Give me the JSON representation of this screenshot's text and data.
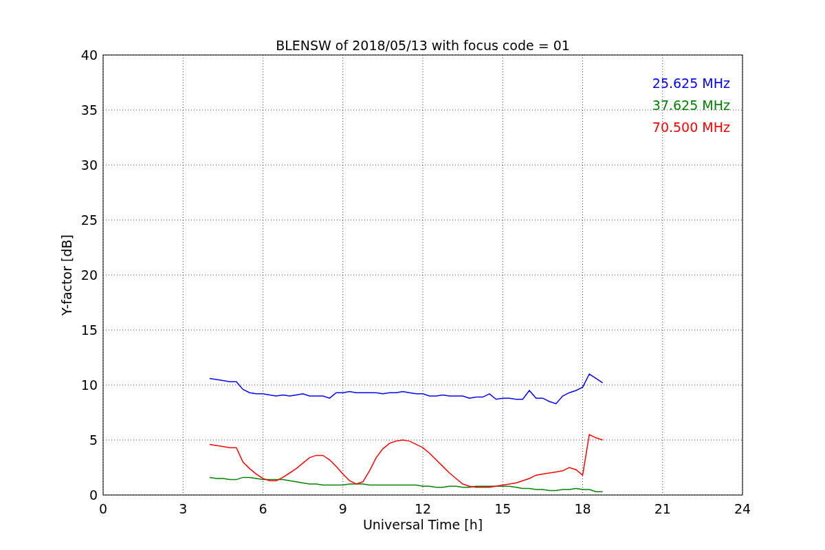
{
  "figure": {
    "chart_data": {
      "type": "line",
      "title": "BLENSW of 2018/05/13 with focus code = 01",
      "xlabel": "Universal Time [h]",
      "ylabel": "Y-factor [dB]",
      "grid": true,
      "xlim": [
        0,
        24
      ],
      "ylim": [
        0,
        40
      ],
      "xticks": [
        0,
        3,
        6,
        9,
        12,
        15,
        18,
        21,
        24
      ],
      "yticks": [
        0,
        5,
        10,
        15,
        20,
        25,
        30,
        35,
        40
      ],
      "x": [
        4,
        4.25,
        4.5,
        4.75,
        5,
        5.25,
        5.5,
        5.75,
        6,
        6.25,
        6.5,
        6.75,
        7,
        7.25,
        7.5,
        7.75,
        8,
        8.25,
        8.5,
        8.75,
        9,
        9.25,
        9.5,
        9.75,
        10,
        10.25,
        10.5,
        10.75,
        11,
        11.25,
        11.5,
        11.75,
        12,
        12.25,
        12.5,
        12.75,
        13,
        13.25,
        13.5,
        13.75,
        14,
        14.25,
        14.5,
        14.75,
        15,
        15.25,
        15.5,
        15.75,
        16,
        16.25,
        16.5,
        16.75,
        17,
        17.25,
        17.5,
        17.75,
        18,
        18.25,
        18.5,
        18.75
      ],
      "series": [
        {
          "name": "25.625 MHz",
          "color": "#0000ff",
          "values": [
            10.6,
            10.5,
            10.4,
            10.3,
            10.3,
            9.6,
            9.3,
            9.2,
            9.2,
            9.1,
            9.0,
            9.1,
            9.0,
            9.1,
            9.2,
            9.0,
            9.0,
            9.0,
            8.8,
            9.3,
            9.3,
            9.4,
            9.3,
            9.3,
            9.3,
            9.3,
            9.2,
            9.3,
            9.3,
            9.4,
            9.3,
            9.2,
            9.2,
            9.0,
            9.0,
            9.1,
            9.0,
            9.0,
            9.0,
            8.8,
            8.9,
            8.9,
            9.2,
            8.7,
            8.8,
            8.8,
            8.7,
            8.7,
            9.5,
            8.8,
            8.8,
            8.5,
            8.3,
            9.0,
            9.3,
            9.5,
            9.8,
            11.0,
            10.6,
            10.2
          ]
        },
        {
          "name": "37.625 MHz",
          "color": "#008000",
          "values": [
            1.6,
            1.5,
            1.5,
            1.4,
            1.4,
            1.6,
            1.6,
            1.5,
            1.4,
            1.4,
            1.4,
            1.4,
            1.3,
            1.2,
            1.1,
            1.0,
            1.0,
            0.9,
            0.9,
            0.9,
            0.9,
            1.0,
            1.0,
            1.0,
            0.9,
            0.9,
            0.9,
            0.9,
            0.9,
            0.9,
            0.9,
            0.9,
            0.8,
            0.8,
            0.7,
            0.7,
            0.8,
            0.8,
            0.7,
            0.7,
            0.8,
            0.8,
            0.8,
            0.8,
            0.8,
            0.8,
            0.7,
            0.6,
            0.6,
            0.5,
            0.5,
            0.4,
            0.4,
            0.5,
            0.5,
            0.6,
            0.5,
            0.5,
            0.3,
            0.3
          ]
        },
        {
          "name": "70.500 MHz",
          "color": "#ff0000",
          "values": [
            4.6,
            4.5,
            4.4,
            4.3,
            4.3,
            3.0,
            2.4,
            1.9,
            1.5,
            1.3,
            1.3,
            1.6,
            2.0,
            2.4,
            2.9,
            3.4,
            3.6,
            3.6,
            3.2,
            2.6,
            1.9,
            1.3,
            1.0,
            1.2,
            2.2,
            3.4,
            4.2,
            4.7,
            4.9,
            5.0,
            4.9,
            4.6,
            4.3,
            3.8,
            3.2,
            2.6,
            2.0,
            1.5,
            1.0,
            0.8,
            0.7,
            0.7,
            0.7,
            0.8,
            0.9,
            1.0,
            1.1,
            1.3,
            1.5,
            1.8,
            1.9,
            2.0,
            2.1,
            2.2,
            2.5,
            2.3,
            1.8,
            5.5,
            5.2,
            5.0
          ]
        }
      ]
    }
  }
}
